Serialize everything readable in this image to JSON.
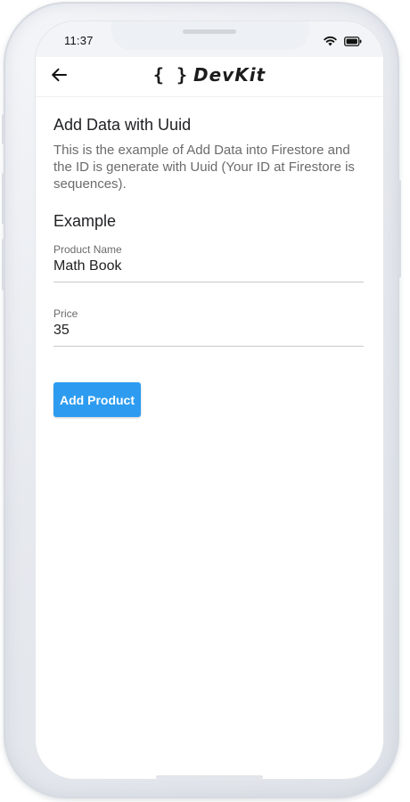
{
  "status_bar": {
    "time": "11:37",
    "icons": [
      "wifi-icon",
      "battery-icon"
    ]
  },
  "app_bar": {
    "back_icon": "arrow-left-icon",
    "logo_braces": "{ }",
    "logo_name": "DevKit"
  },
  "main": {
    "title": "Add Data with Uuid",
    "description": "This is the example of Add Data into Firestore and the ID is generate with Uuid (Your ID at Firestore is sequences).",
    "section_title": "Example",
    "fields": [
      {
        "label": "Product Name",
        "value": "Math Book"
      },
      {
        "label": "Price",
        "value": "35"
      }
    ],
    "add_button_label": "Add Product"
  },
  "colors": {
    "accent": "#2d9cf0",
    "text_primary": "#202124",
    "text_secondary": "#6b6b6b"
  }
}
